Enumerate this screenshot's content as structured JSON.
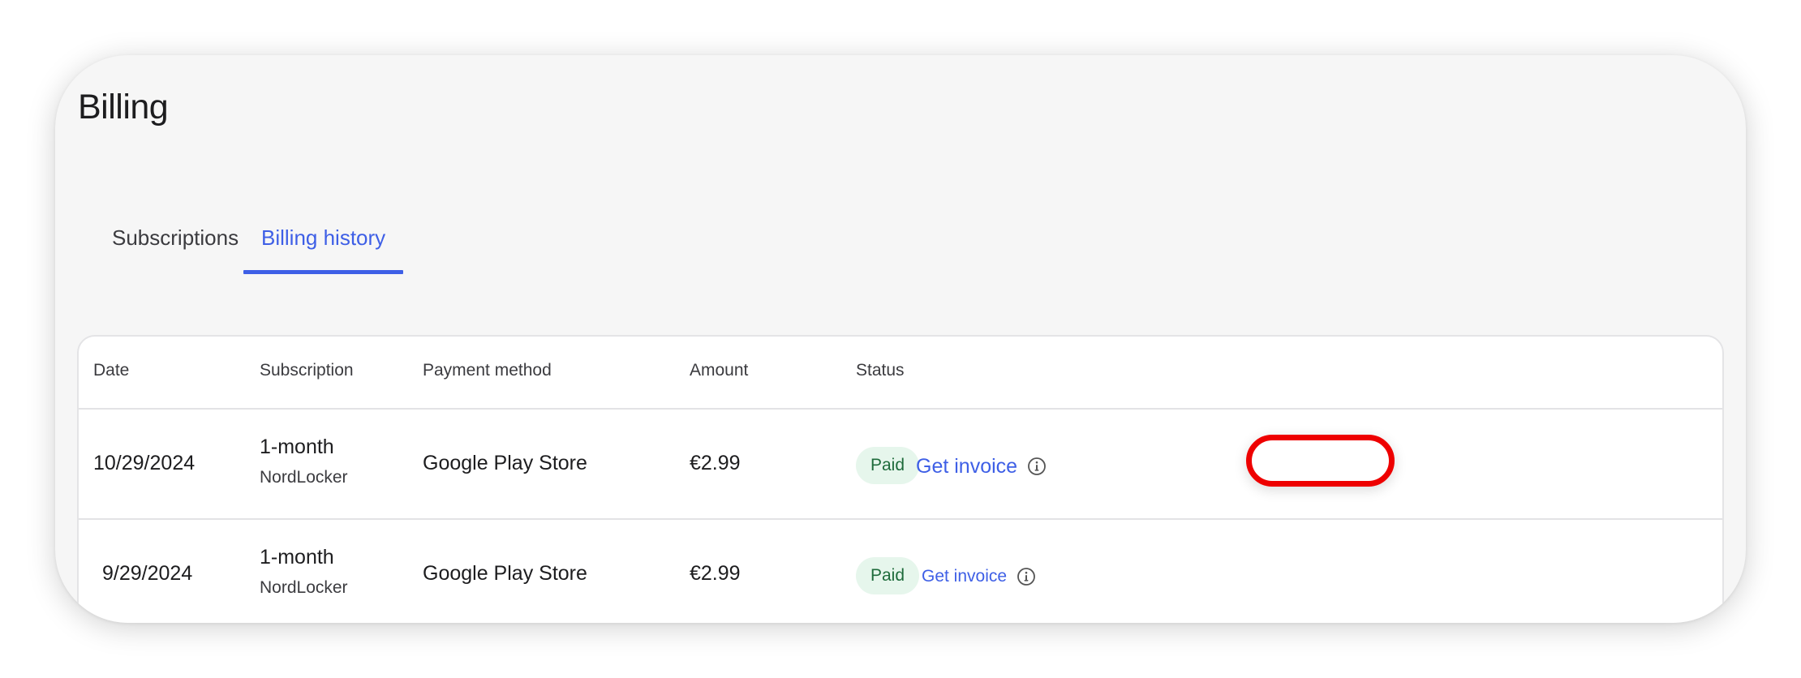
{
  "page": {
    "title": "Billing"
  },
  "tabs": [
    {
      "label": "Subscriptions",
      "active": false
    },
    {
      "label": "Billing history",
      "active": true
    }
  ],
  "table": {
    "headers": [
      "Date",
      "Subscription",
      "Payment method",
      "Amount",
      "Status"
    ],
    "rows": [
      {
        "date": "10/29/2024",
        "subscription": "1-month",
        "product": "NordLocker",
        "payment_method": "Google Play Store",
        "amount": "€2.99",
        "status": "Paid",
        "action": "Get invoice"
      },
      {
        "date": "9/29/2024",
        "subscription": "1-month",
        "product": "NordLocker",
        "payment_method": "Google Play Store",
        "amount": "€2.99",
        "status": "Paid",
        "action": "Get invoice"
      }
    ]
  },
  "icons": {
    "info": "info-circle-icon"
  },
  "colors": {
    "accent": "#3e5fe6",
    "paid_badge_bg": "#e6f6ec",
    "paid_badge_text": "#1e6b3b",
    "highlight": "#ee0000"
  }
}
